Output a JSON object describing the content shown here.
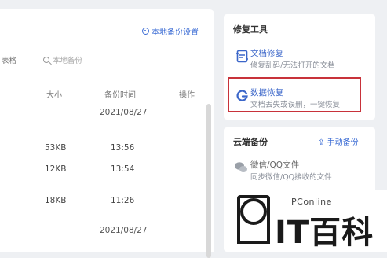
{
  "left_panel": {
    "settings_link": "本地备份设置",
    "filter_label": "表格",
    "search": {
      "placeholder": "本地备份"
    },
    "columns": {
      "size": "大小",
      "time": "备份时间",
      "action": "操作"
    },
    "rows": [
      {
        "type": "date",
        "time": "2021/08/27"
      },
      {
        "type": "item",
        "size": "53KB",
        "time": "13:56"
      },
      {
        "type": "item",
        "size": "12KB",
        "time": "13:54"
      },
      {
        "type": "item",
        "size": "18KB",
        "time": "11:26"
      },
      {
        "type": "date",
        "time": "2021/08/27"
      }
    ]
  },
  "repair_tools": {
    "title": "修复工具",
    "items": [
      {
        "icon": "document-repair-icon",
        "name": "文档修复",
        "desc": "修复乱码/无法打开的文档"
      },
      {
        "icon": "data-recovery-icon",
        "name": "数据恢复",
        "desc": "文档丢失或误删，一键恢复",
        "highlighted": true
      }
    ]
  },
  "cloud_backup": {
    "title": "云端备份",
    "manual_backup": "手动备份",
    "items": [
      {
        "icon": "wechat-qq-icon",
        "name": "微信/QQ文件",
        "desc": "同步微信/QQ接收的文件"
      }
    ]
  },
  "watermark": {
    "brand_small": "PConline",
    "brand_large": "IT百科"
  },
  "colors": {
    "accent": "#3a6bd4",
    "highlight_border": "#c8323a",
    "background": "#eef0f3"
  }
}
